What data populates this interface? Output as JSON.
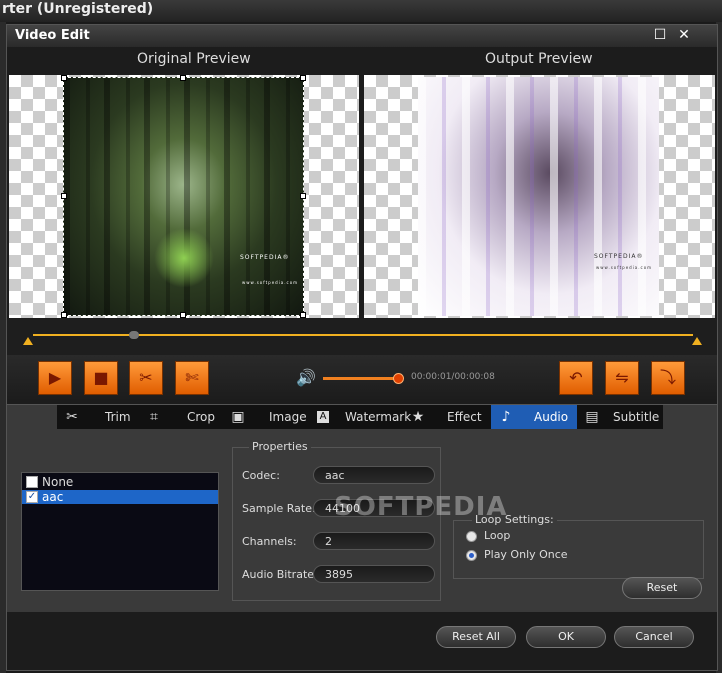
{
  "parent_window": {
    "title": "rter (Unregistered)"
  },
  "dialog": {
    "title": "Video Edit",
    "maximize_glyph": "☐",
    "close_glyph": "✕"
  },
  "preview": {
    "original_label": "Original Preview",
    "output_label": "Output Preview",
    "watermark_text": "SOFTPEDIA®",
    "watermark_url": "www.softpedia.com"
  },
  "playback": {
    "play_icon": "play-icon",
    "stop_icon": "stop-icon",
    "cut_icon": "scissors-icon",
    "split_icon": "split-icon",
    "volume_level": 0.95,
    "time": "00:00:01/00:00:08",
    "undo_icon": "undo-icon",
    "flip_icon": "flip-icon",
    "rotate_icon": "rotate-icon"
  },
  "tabs": [
    {
      "label": "Trim",
      "icon": "scissors-icon",
      "glyph": "✂"
    },
    {
      "label": "Crop",
      "icon": "crop-icon",
      "glyph": "⌗"
    },
    {
      "label": "Image",
      "icon": "image-icon",
      "glyph": "▣"
    },
    {
      "label": "Watermark",
      "icon": "watermark-icon",
      "glyph": "A"
    },
    {
      "label": "Effect",
      "icon": "star-icon",
      "glyph": "★"
    },
    {
      "label": "Audio",
      "icon": "music-note-icon",
      "glyph": "♪"
    },
    {
      "label": "Subtitle",
      "icon": "subtitle-icon",
      "glyph": "▤"
    }
  ],
  "active_tab": "Audio",
  "audio_tracks": [
    {
      "label": "None",
      "checked": false,
      "selected": false
    },
    {
      "label": "aac",
      "checked": true,
      "selected": true
    }
  ],
  "properties": {
    "title": "Properties",
    "fields": [
      {
        "label": "Codec:",
        "value": "aac"
      },
      {
        "label": "Sample Rate:",
        "value": "44100"
      },
      {
        "label": "Channels:",
        "value": "2"
      },
      {
        "label": "Audio Bitrate:",
        "value": "3895"
      }
    ]
  },
  "loop_settings": {
    "title": "Loop Settings:",
    "options": [
      {
        "label": "Loop",
        "selected": false
      },
      {
        "label": "Play Only Once",
        "selected": true
      }
    ]
  },
  "buttons": {
    "reset": "Reset",
    "reset_all": "Reset All",
    "ok": "OK",
    "cancel": "Cancel"
  },
  "watermark_overlay": "SOFTPEDIA",
  "colors": {
    "accent": "#f08020",
    "tab_active": "#1f5db4",
    "selection": "#1e66c8"
  }
}
